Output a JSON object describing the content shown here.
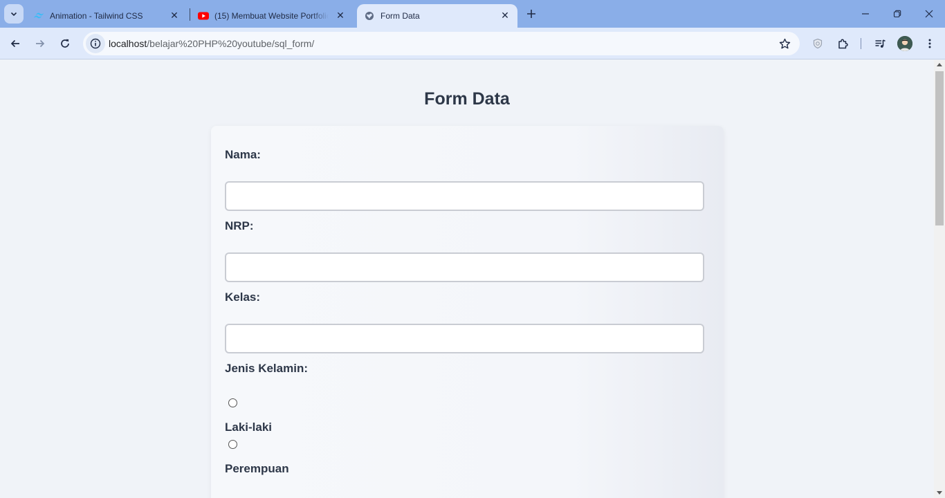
{
  "browser": {
    "tabs": [
      {
        "title": "Animation - Tailwind CSS",
        "icon": "tailwind-icon"
      },
      {
        "title": "(15) Membuat Website Portfolio",
        "icon": "youtube-icon"
      },
      {
        "title": "Form Data",
        "icon": "globe-icon"
      }
    ],
    "active_tab": 2,
    "address": {
      "host": "localhost",
      "path": "/belajar%20PHP%20youtube/sql_form/"
    },
    "colors": {
      "tabstrip": "#8aaee8",
      "toolbar": "#dfe9fb",
      "youtube": "#ff0000",
      "tailwind": "#38bdf8"
    }
  },
  "page": {
    "title": "Form Data",
    "form": {
      "nama_label": "Nama:",
      "nama_value": "",
      "nrp_label": "NRP:",
      "nrp_value": "",
      "kelas_label": "Kelas:",
      "kelas_value": "",
      "gender_label": "Jenis Kelamin:",
      "gender_options": [
        "Laki-laki",
        "Perempuan"
      ]
    }
  }
}
